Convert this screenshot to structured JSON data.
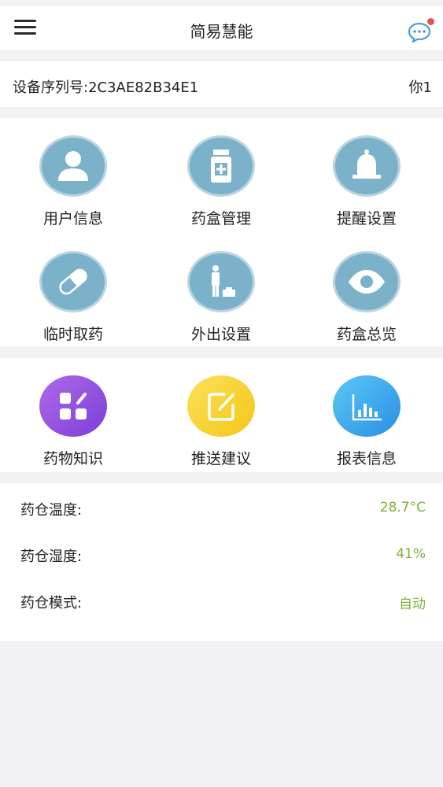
{
  "app": {
    "title": "简易慧能"
  },
  "device": {
    "serial_label": "设备序列号:2C3AE82B34E1",
    "user": "你1"
  },
  "grid_a": [
    {
      "label": "用户信息",
      "icon": "user-icon"
    },
    {
      "label": "药盒管理",
      "icon": "medicine-bottle-icon"
    },
    {
      "label": "提醒设置",
      "icon": "bell-icon"
    },
    {
      "label": "临时取药",
      "icon": "capsule-icon"
    },
    {
      "label": "外出设置",
      "icon": "traveler-icon"
    },
    {
      "label": "药盒总览",
      "icon": "eye-icon"
    }
  ],
  "grid_b": [
    {
      "label": "药物知识",
      "icon": "apps-icon"
    },
    {
      "label": "推送建议",
      "icon": "edit-icon"
    },
    {
      "label": "报表信息",
      "icon": "bar-chart-icon"
    }
  ],
  "environment": [
    {
      "label": "药仓温度:",
      "value": "28.7°C"
    },
    {
      "label": "药仓湿度:",
      "value": "41%"
    },
    {
      "label": "药仓模式:",
      "value": "自动"
    }
  ],
  "colors": {
    "icon_blue": "#7cb1ca",
    "value_green": "#7ab339",
    "badge_red": "#e5534b"
  }
}
